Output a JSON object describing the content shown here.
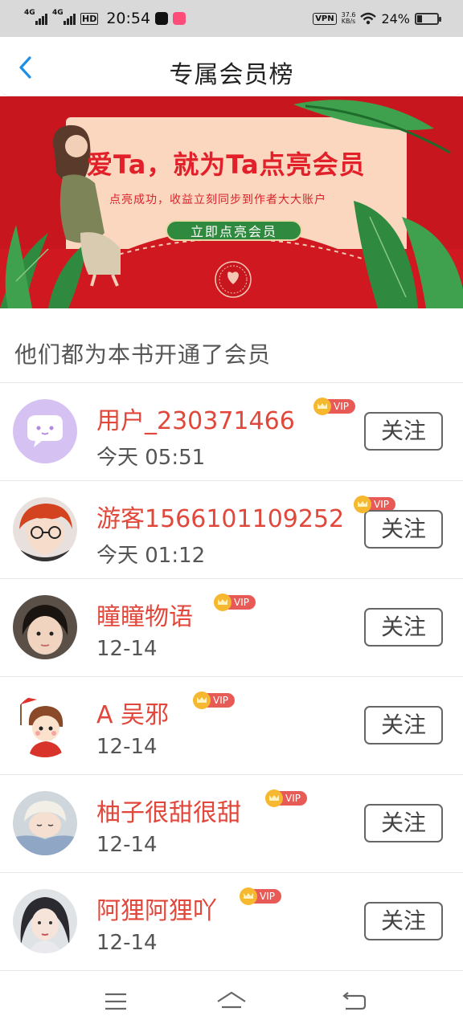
{
  "status_bar": {
    "network1": "4G",
    "network2": "4G",
    "hd": "HD",
    "time": "20:54",
    "vpn": "VPN",
    "speed_value": "37.6",
    "speed_unit": "KB/s",
    "battery": "24%",
    "battery_level": 0.24
  },
  "nav": {
    "back_icon": "chevron-left-icon",
    "title": "专属会员榜"
  },
  "banner": {
    "headline": "爱Ta，就为Ta点亮会员",
    "subtext": "点亮成功，收益立刻同步到作者大大账户",
    "button_label": "立即点亮会员",
    "colors": {
      "background": "#c8161e",
      "card": "#fbd7c0",
      "button": "#2f8a3f"
    }
  },
  "section": {
    "title": "他们都为本书开通了会员"
  },
  "members": [
    {
      "name": "用户_230371466",
      "time": "今天  05:51",
      "vip": "VIP",
      "follow": "关注",
      "avatar": "default-chat-avatar"
    },
    {
      "name": "游客1566101109252",
      "time": "今天  01:12",
      "vip": "VIP",
      "follow": "关注",
      "avatar": "anime-redhair-glasses"
    },
    {
      "name": "瞳瞳物语",
      "time": "12-14",
      "vip": "VIP",
      "follow": "关注",
      "avatar": "child-photo"
    },
    {
      "name": "A  吴邪",
      "time": "12-14",
      "vip": "VIP",
      "follow": "关注",
      "avatar": "cartoon-girl-flag"
    },
    {
      "name": "柚子很甜很甜",
      "time": "12-14",
      "vip": "VIP",
      "follow": "关注",
      "avatar": "sleeping-boy-photo"
    },
    {
      "name": "阿狸阿狸吖",
      "time": "12-14",
      "vip": "VIP",
      "follow": "关注",
      "avatar": "ancient-style-girl"
    }
  ],
  "system_nav": {
    "menu_icon": "menu-icon",
    "home_icon": "home-icon",
    "back_icon": "back-icon"
  },
  "colors": {
    "accent_name": "#e1473a",
    "vip_tag": "#e85a56",
    "vip_crown": "#f5b82e",
    "nav_back": "#1e8fe6"
  }
}
